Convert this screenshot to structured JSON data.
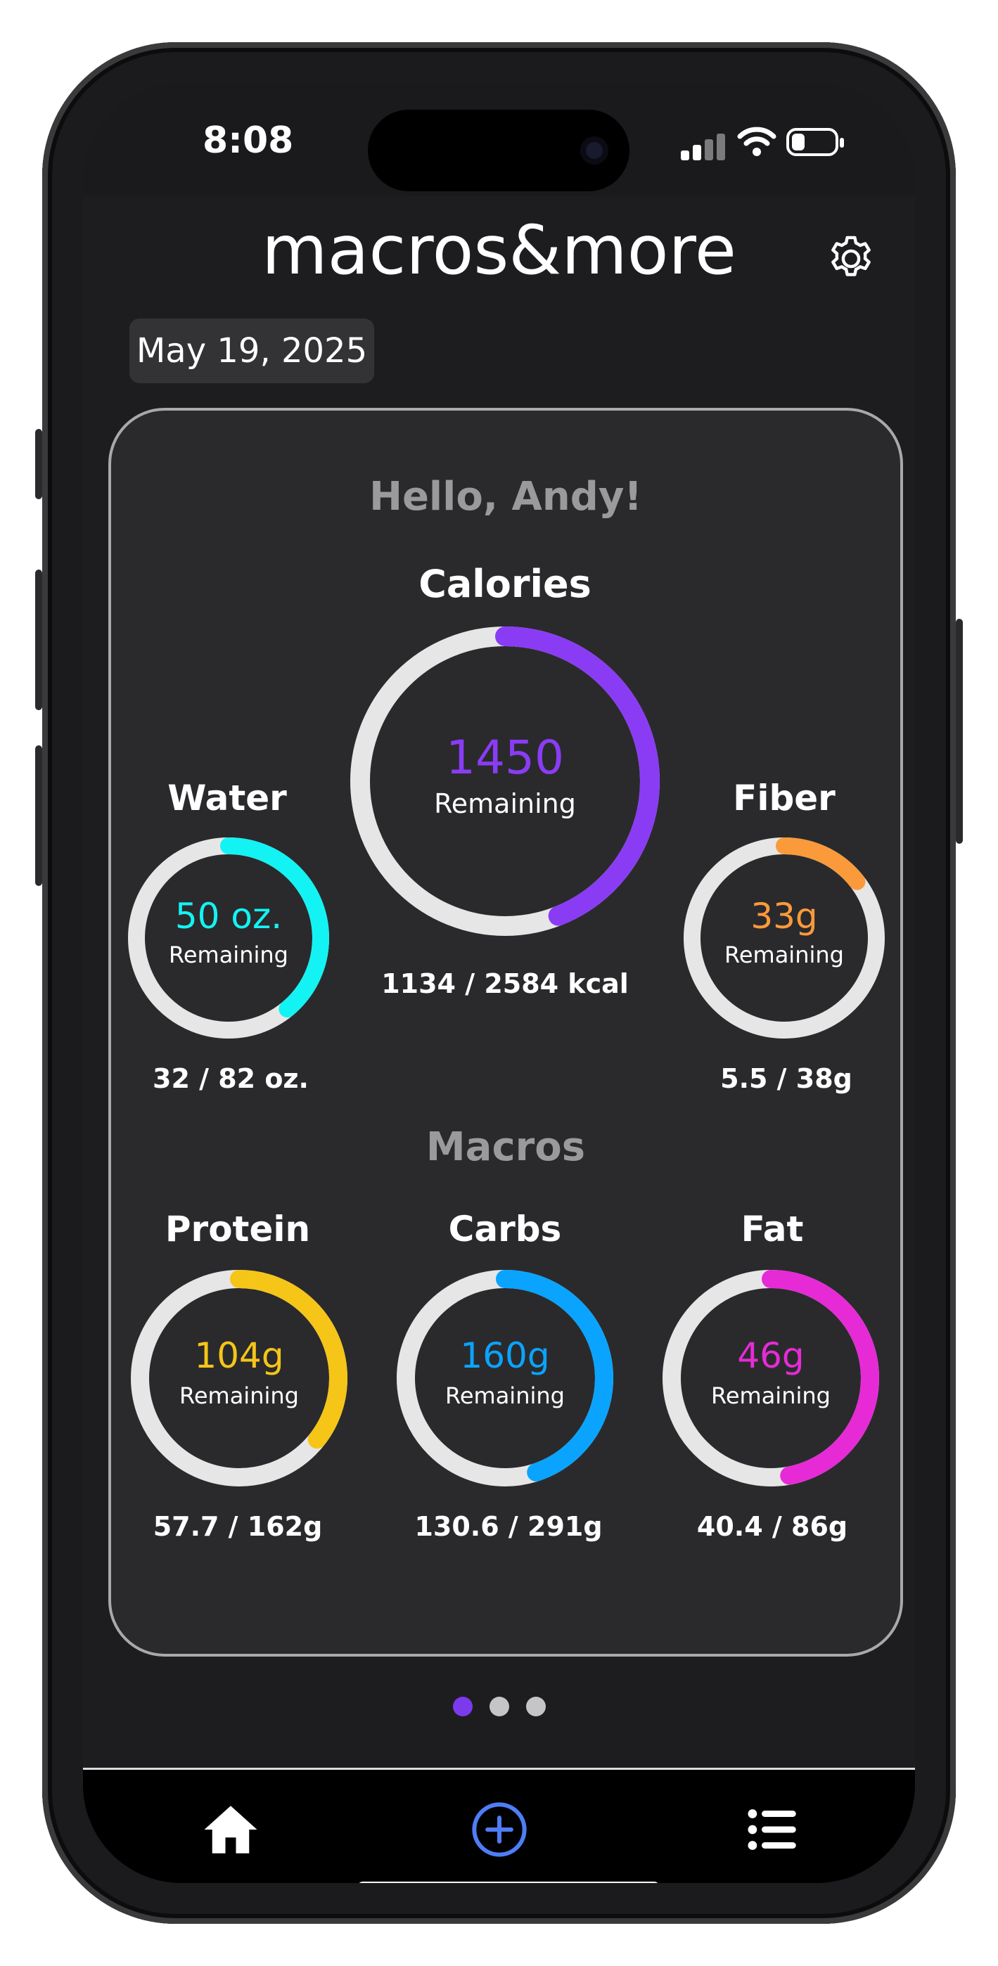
{
  "status_bar": {
    "time": "8:08"
  },
  "header": {
    "app_title": "macros&more"
  },
  "date_chip": {
    "label": "May 19, 2025"
  },
  "dashboard": {
    "greeting": "Hello, Andy!",
    "calories": {
      "title": "Calories",
      "value": "1450",
      "sub": "Remaining",
      "total": "1134 / 2584 kcal",
      "progress": 0.44,
      "color": "#8a3cf5"
    },
    "water": {
      "title": "Water",
      "value": "50 oz.",
      "sub": "Remaining",
      "total": "32 / 82 oz.",
      "progress": 0.39,
      "color": "#13f3f3"
    },
    "fiber": {
      "title": "Fiber",
      "value": "33g",
      "sub": "Remaining",
      "total": "5.5 / 38g",
      "progress": 0.145,
      "color": "#fa9a3b"
    },
    "macros_title": "Macros",
    "protein": {
      "title": "Protein",
      "value": "104g",
      "sub": "Remaining",
      "total": "57.7 / 162g",
      "progress": 0.356,
      "color": "#f5c518"
    },
    "carbs": {
      "title": "Carbs",
      "value": "160g",
      "sub": "Remaining",
      "total": "130.6 / 291g",
      "progress": 0.449,
      "color": "#0aa4ff"
    },
    "fat": {
      "title": "Fat",
      "value": "46g",
      "sub": "Remaining",
      "total": "40.4 / 86g",
      "progress": 0.47,
      "color": "#e62bd6"
    }
  },
  "pager": {
    "count": 3,
    "active": 0
  },
  "tab_bar": {
    "items": [
      "home-icon",
      "add-circle-icon",
      "list-icon"
    ],
    "active_color": "#4f7df7"
  }
}
